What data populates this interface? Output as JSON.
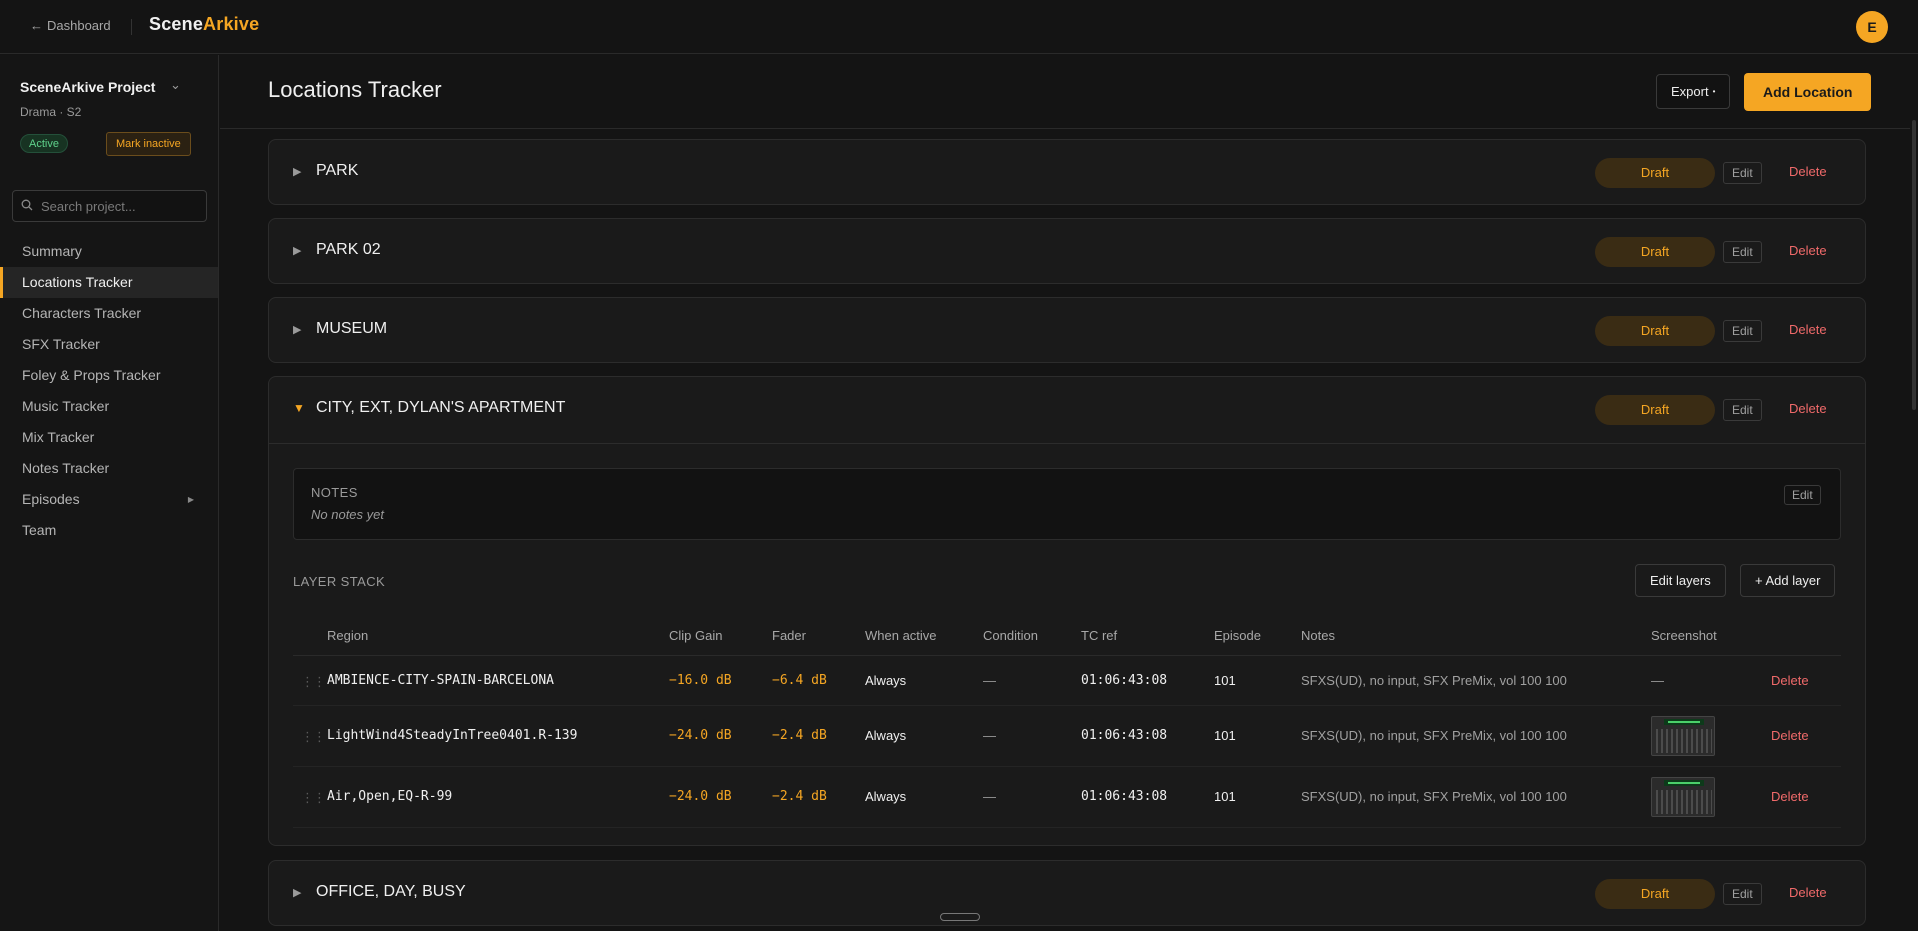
{
  "topbar": {
    "back_label": "Dashboard",
    "brand_part1": "Scene",
    "brand_part2": "Arkive",
    "user_initial": "E"
  },
  "sidebar": {
    "project_name": "SceneArkive Project",
    "project_sub": "Drama · S2",
    "status_badge": "Active",
    "mark_inactive_label": "Mark inactive",
    "search_placeholder": "Search project...",
    "items": [
      {
        "label": "Summary"
      },
      {
        "label": "Locations Tracker"
      },
      {
        "label": "Characters Tracker"
      },
      {
        "label": "SFX Tracker"
      },
      {
        "label": "Foley & Props Tracker"
      },
      {
        "label": "Music Tracker"
      },
      {
        "label": "Mix Tracker"
      },
      {
        "label": "Notes Tracker"
      },
      {
        "label": "Episodes"
      },
      {
        "label": "Team"
      }
    ]
  },
  "header": {
    "title": "Locations Tracker",
    "export_label": "Export",
    "add_location_label": "Add Location"
  },
  "locations": [
    {
      "name": "PARK",
      "status": "Draft",
      "edit_label": "Edit",
      "delete_label": "Delete"
    },
    {
      "name": "PARK 02",
      "status": "Draft",
      "edit_label": "Edit",
      "delete_label": "Delete"
    },
    {
      "name": "MUSEUM",
      "status": "Draft",
      "edit_label": "Edit",
      "delete_label": "Delete"
    },
    {
      "name": "CITY, EXT, DYLAN'S APARTMENT",
      "status": "Draft",
      "edit_label": "Edit",
      "delete_label": "Delete"
    },
    {
      "name": "OFFICE, DAY, BUSY",
      "status": "Draft",
      "edit_label": "Edit",
      "delete_label": "Delete"
    }
  ],
  "expanded": {
    "notes_label": "NOTES",
    "notes_empty": "No notes yet",
    "notes_edit_label": "Edit",
    "layer_stack_label": "LAYER STACK",
    "edit_layers_label": "Edit layers",
    "add_layer_label": "+ Add layer",
    "columns": [
      "Region",
      "Clip Gain",
      "Fader",
      "When active",
      "Condition",
      "TC ref",
      "Episode",
      "Notes",
      "Screenshot"
    ],
    "rows": [
      {
        "region": "AMBIENCE-CITY-SPAIN-BARCELONA",
        "clip_gain": "−16.0 dB",
        "fader": "−6.4 dB",
        "when_active": "Always",
        "condition": "—",
        "tc_ref": "01:06:43:08",
        "episode": "101",
        "notes": "SFXS(UD), no input, SFX PreMix, vol 100 100",
        "screenshot": "—",
        "delete_label": "Delete"
      },
      {
        "region": "LightWind4SteadyInTree0401.R-139",
        "clip_gain": "−24.0 dB",
        "fader": "−2.4 dB",
        "when_active": "Always",
        "condition": "—",
        "tc_ref": "01:06:43:08",
        "episode": "101",
        "notes": "SFXS(UD), no input, SFX PreMix, vol 100 100",
        "screenshot": "thumbnail",
        "delete_label": "Delete"
      },
      {
        "region": "Air,Open,EQ-R-99",
        "clip_gain": "−24.0 dB",
        "fader": "−2.4 dB",
        "when_active": "Always",
        "condition": "—",
        "tc_ref": "01:06:43:08",
        "episode": "101",
        "notes": "SFXS(UD), no input, SFX PreMix, vol 100 100",
        "screenshot": "thumbnail",
        "delete_label": "Delete"
      }
    ]
  },
  "colors": {
    "accent": "#f5a623",
    "danger": "#f06a6a",
    "success": "#5fd28b",
    "background": "#141414"
  }
}
